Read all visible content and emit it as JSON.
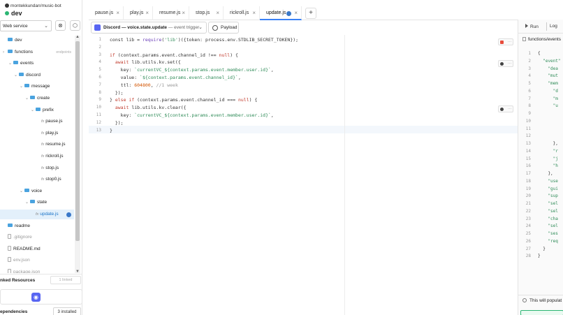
{
  "project": {
    "user_repo": "montekkundan/music-bot",
    "environment": "dev"
  },
  "sidebar": {
    "env_select": "Web service",
    "tree": [
      {
        "label": "dev",
        "type": "root",
        "depth": 0,
        "caret": ""
      },
      {
        "label": "functions",
        "type": "folder",
        "depth": 0,
        "caret": "›",
        "hint": "endpoints"
      },
      {
        "label": "events",
        "type": "folder",
        "depth": 1,
        "caret": "⌄"
      },
      {
        "label": "discord",
        "type": "folder",
        "depth": 2,
        "caret": "⌄"
      },
      {
        "label": "message",
        "type": "folder",
        "depth": 3,
        "caret": "⌄"
      },
      {
        "label": "create",
        "type": "folder",
        "depth": 4,
        "caret": "⌄"
      },
      {
        "label": "prefix",
        "type": "folder",
        "depth": 5,
        "caret": "⌄"
      },
      {
        "label": "pause.js",
        "type": "fn",
        "depth": 6,
        "caret": ""
      },
      {
        "label": "play.js",
        "type": "fn",
        "depth": 6,
        "caret": ""
      },
      {
        "label": "resume.js",
        "type": "fn",
        "depth": 6,
        "caret": ""
      },
      {
        "label": "rickroll.js",
        "type": "fn",
        "depth": 6,
        "caret": ""
      },
      {
        "label": "stop.js",
        "type": "fn",
        "depth": 6,
        "caret": ""
      },
      {
        "label": "stop0.js",
        "type": "fn",
        "depth": 6,
        "caret": ""
      },
      {
        "label": "voice",
        "type": "folder",
        "depth": 3,
        "caret": "⌄"
      },
      {
        "label": "state",
        "type": "folder",
        "depth": 4,
        "caret": "⌄"
      },
      {
        "label": "update.js",
        "type": "fn",
        "depth": 5,
        "caret": "",
        "active": true
      },
      {
        "label": "readme",
        "type": "folder",
        "depth": 0,
        "caret": ""
      },
      {
        "label": ".gitignore",
        "type": "file",
        "depth": 0,
        "caret": "",
        "muted": true
      },
      {
        "label": "README.md",
        "type": "file",
        "depth": 0,
        "caret": ""
      },
      {
        "label": "env.json",
        "type": "file",
        "depth": 0,
        "caret": "",
        "muted": true
      },
      {
        "label": "package.json",
        "type": "file",
        "depth": 0,
        "caret": "",
        "muted": true
      }
    ],
    "fn_prefix": "fx",
    "linked_label": "nked Resources",
    "linked_count": "1 linked",
    "deps_label": "ependencies",
    "deps_count": "3 installed"
  },
  "tabs": [
    {
      "label": "pause.js"
    },
    {
      "label": "play.js"
    },
    {
      "label": "resume.js"
    },
    {
      "label": "stop.js"
    },
    {
      "label": "rickroll.js"
    },
    {
      "label": "update.js",
      "active": true
    }
  ],
  "trigger": {
    "title": "Discord — voice.state.update",
    "sub": "— event trigger",
    "payload": "Payload"
  },
  "editor": {
    "lines": [
      [
        [
          "",
          "const lib = "
        ],
        [
          "fn",
          "require"
        ],
        [
          "",
          "("
        ],
        [
          "str",
          "'lib'"
        ],
        [
          "",
          ")({token: process.env.STDLIB_SECRET_TOKEN});"
        ]
      ],
      [],
      [
        [
          "kw",
          "if"
        ],
        [
          "",
          " (context.params.event.channel_id !== "
        ],
        [
          "kw",
          "null"
        ],
        [
          "",
          ") {"
        ]
      ],
      [
        [
          "",
          "  "
        ],
        [
          "kw",
          "await"
        ],
        [
          "",
          " lib.utils.kv.set({"
        ]
      ],
      [
        [
          "",
          "    key: "
        ],
        [
          "str",
          "`currentVC_${context.params.event.member.user.id}`"
        ],
        [
          "",
          ","
        ]
      ],
      [
        [
          "",
          "    value: "
        ],
        [
          "str",
          "`${context.params.event.channel_id}`"
        ],
        [
          "",
          ","
        ]
      ],
      [
        [
          "",
          "    ttl: "
        ],
        [
          "num",
          "604800"
        ],
        [
          "",
          ", "
        ],
        [
          "cm",
          "//1 week"
        ]
      ],
      [
        [
          "",
          "  });"
        ]
      ],
      [
        [
          "",
          "} "
        ],
        [
          "kw",
          "else if"
        ],
        [
          "",
          " (context.params.event.channel_id === "
        ],
        [
          "kw",
          "null"
        ],
        [
          "",
          ") {"
        ]
      ],
      [
        [
          "",
          "  "
        ],
        [
          "kw",
          "await"
        ],
        [
          "",
          " lib.utils.kv.clear({"
        ]
      ],
      [
        [
          "",
          "    key: "
        ],
        [
          "str",
          "`currentVC_${context.params.event.member.user.id}`"
        ],
        [
          "",
          ","
        ]
      ],
      [
        [
          "",
          "  });"
        ]
      ],
      [
        [
          "",
          "}"
        ]
      ]
    ]
  },
  "right_panel": {
    "run_label": "Run",
    "logs_label": "Log",
    "file_path": "functions/events",
    "json_lines": [
      {
        "t": "{",
        "c": "pn"
      },
      {
        "t": "  \"event\"",
        "c": ""
      },
      {
        "t": "    \"dea",
        "c": ""
      },
      {
        "t": "    \"mut",
        "c": ""
      },
      {
        "t": "    \"mem",
        "c": ""
      },
      {
        "t": "      \"d",
        "c": ""
      },
      {
        "t": "      \"m",
        "c": ""
      },
      {
        "t": "      \"u",
        "c": ""
      },
      {
        "t": "        ",
        "c": ""
      },
      {
        "t": "        ",
        "c": ""
      },
      {
        "t": "        ",
        "c": ""
      },
      {
        "t": "        ",
        "c": ""
      },
      {
        "t": "      },",
        "c": "pn"
      },
      {
        "t": "      \"r",
        "c": ""
      },
      {
        "t": "      \"j",
        "c": ""
      },
      {
        "t": "      \"h",
        "c": ""
      },
      {
        "t": "    },",
        "c": "pn"
      },
      {
        "t": "    \"use",
        "c": ""
      },
      {
        "t": "    \"gui",
        "c": ""
      },
      {
        "t": "    \"sup",
        "c": ""
      },
      {
        "t": "    \"sel",
        "c": ""
      },
      {
        "t": "    \"sel",
        "c": ""
      },
      {
        "t": "    \"cha",
        "c": ""
      },
      {
        "t": "    \"sel",
        "c": ""
      },
      {
        "t": "    \"ses",
        "c": ""
      },
      {
        "t": "    \"req",
        "c": ""
      },
      {
        "t": "  }",
        "c": "pn"
      },
      {
        "t": "}",
        "c": "pn"
      }
    ],
    "info_text": "This will populat"
  }
}
